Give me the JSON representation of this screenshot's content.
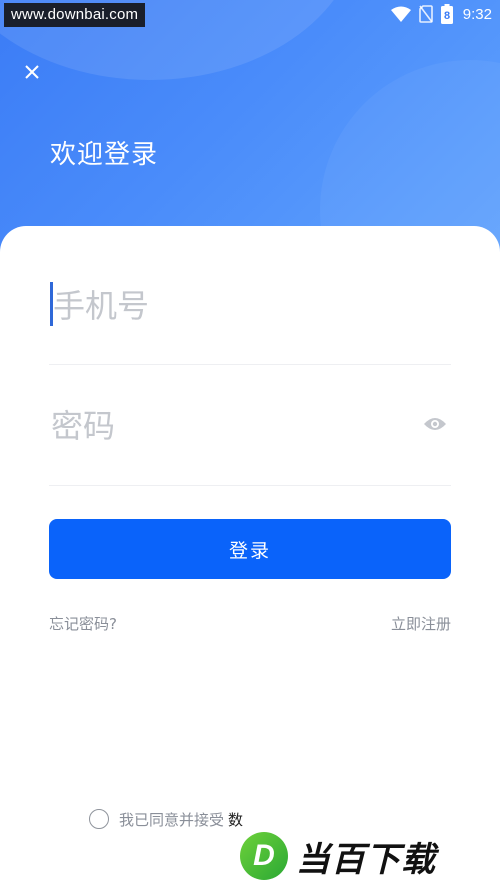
{
  "watermark_top": "www.downbai.com",
  "status_bar": {
    "time": "9:32",
    "battery_level": "8",
    "icons": [
      "wifi-icon",
      "no-sim-icon",
      "battery-icon"
    ]
  },
  "header": {
    "close_icon": "close-icon",
    "title": "欢迎登录"
  },
  "form": {
    "phone_placeholder": "手机号",
    "phone_value": "",
    "password_placeholder": "密码",
    "password_value": "",
    "eye_icon": "eye-icon",
    "login_label": "登录",
    "forgot_label": "忘记密码?",
    "register_label": "立即注册"
  },
  "agreement": {
    "prefix": "我已同意并接受",
    "user_agreement": "数",
    "and": "",
    "privacy": ""
  },
  "watermark_bottom": {
    "logo_letter": "D",
    "text": "当百下载"
  },
  "colors": {
    "accent": "#0a63fa",
    "hero_start": "#3b7cf6",
    "hero_end": "#62a4fd",
    "muted": "#8a8f99",
    "caret": "#2f68d8"
  }
}
